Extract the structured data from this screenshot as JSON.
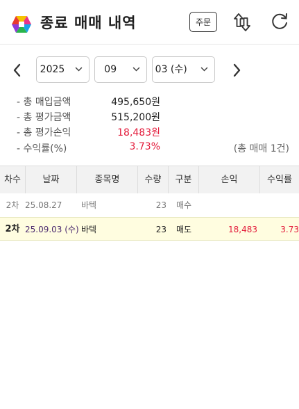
{
  "header": {
    "title": "종료 매매 내역",
    "order_label": "주문"
  },
  "date_selector": {
    "year": "2025",
    "month": "09",
    "day": "03 (수)"
  },
  "summary": {
    "items": [
      {
        "label": "- 총 매입금액",
        "value": "495,650원"
      },
      {
        "label": "- 총 평가금액",
        "value": "515,200원"
      },
      {
        "label": "- 총 평가손익",
        "value": "18,483원"
      },
      {
        "label": "- 수익률(%)",
        "value": "3.73%"
      }
    ],
    "count_text": "(총 매매 1건)"
  },
  "table": {
    "headers": [
      "차수",
      "날짜",
      "종목명",
      "수량",
      "구분",
      "손익",
      "수익률"
    ],
    "rows": [
      {
        "idx": "2차",
        "date": "25.08.27",
        "name": "바텍",
        "qty": "23",
        "type": "매수",
        "profit": "",
        "rate": ""
      },
      {
        "idx": "2차",
        "date": "25.09.03 (수)",
        "name": "바텍",
        "qty": "23",
        "type": "매도",
        "profit": "18,483",
        "rate": "3.73"
      }
    ]
  },
  "colors": {
    "accent_red": "#e31b3b",
    "highlight_row": "#fffde0",
    "header_bg": "#f2f2f2"
  },
  "icons": {
    "logo": "app-logo",
    "swap": "swap-vertical-icon",
    "refresh": "refresh-icon",
    "prev": "chevron-left-icon",
    "next": "chevron-right-icon",
    "dropdown": "chevron-down-icon"
  }
}
